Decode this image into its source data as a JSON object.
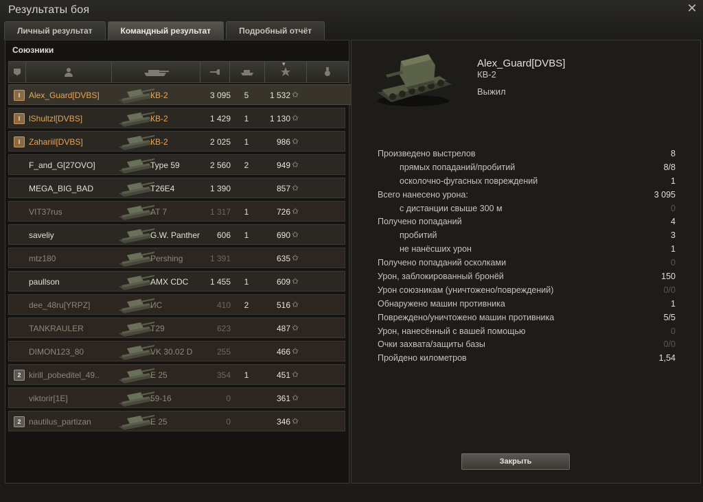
{
  "window": {
    "title": "Результаты боя"
  },
  "tabs": [
    {
      "label": "Личный результат"
    },
    {
      "label": "Командный результат"
    },
    {
      "label": "Подробный отчёт"
    }
  ],
  "allies": {
    "label": "Союзники",
    "columns": [
      "platoon-icon",
      "player-icon",
      "tank-icon",
      "damage-icon",
      "kills-icon",
      "experience-star-icon",
      "medal-icon"
    ],
    "rows": [
      {
        "player": "Alex_Guard[DVBS]",
        "tank": "КВ-2",
        "damage": "3 095",
        "kills": "5",
        "xp": "1 532",
        "platoon": "I",
        "color": "#e8a655"
      },
      {
        "player": "lShultzl[DVBS]",
        "tank": "КВ-2",
        "damage": "1 429",
        "kills": "1",
        "xp": "1 130",
        "platoon": "I",
        "color": "#e8a655"
      },
      {
        "player": "Zahariil[DVBS]",
        "tank": "КВ-2",
        "damage": "2 025",
        "kills": "1",
        "xp": "986",
        "platoon": "I",
        "color": "#e8a655"
      },
      {
        "player": "F_and_G[27OVO]",
        "tank": "Type 59",
        "damage": "2 560",
        "kills": "2",
        "xp": "949",
        "platoon": "",
        "color": "#e2dfd5"
      },
      {
        "player": "MEGA_BIG_BAD",
        "tank": "T26E4",
        "damage": "1 390",
        "kills": "",
        "xp": "857",
        "platoon": "",
        "color": "#e2dfd5"
      },
      {
        "player": "VIT37rus",
        "tank": "AT 7",
        "damage": "1 317",
        "kills": "1",
        "xp": "726",
        "platoon": "",
        "color": "#8b867a"
      },
      {
        "player": "saveliy",
        "tank": "G.W. Panther",
        "damage": "606",
        "kills": "1",
        "xp": "690",
        "platoon": "",
        "color": "#e2dfd5"
      },
      {
        "player": "mtz180",
        "tank": "Pershing",
        "damage": "1 391",
        "kills": "",
        "xp": "635",
        "platoon": "",
        "color": "#8b867a"
      },
      {
        "player": "paullson",
        "tank": "AMX CDC",
        "damage": "1 455",
        "kills": "1",
        "xp": "609",
        "platoon": "",
        "color": "#e2dfd5"
      },
      {
        "player": "dee_48ru[YRPZ]",
        "tank": "ИС",
        "damage": "410",
        "kills": "2",
        "xp": "516",
        "platoon": "",
        "color": "#8b867a"
      },
      {
        "player": "TANKRAULER",
        "tank": "T29",
        "damage": "623",
        "kills": "",
        "xp": "487",
        "platoon": "",
        "color": "#8b867a"
      },
      {
        "player": "DIMON123_80",
        "tank": "VK 30.02 D",
        "damage": "255",
        "kills": "",
        "xp": "466",
        "platoon": "",
        "color": "#8b867a"
      },
      {
        "player": "kirill_pobeditel_49..",
        "tank": "E 25",
        "damage": "354",
        "kills": "1",
        "xp": "451",
        "platoon": "2",
        "color": "#8b867a"
      },
      {
        "player": "viktorir[1E]",
        "tank": "59-16",
        "damage": "0",
        "kills": "",
        "xp": "361",
        "platoon": "",
        "color": "#8b867a"
      },
      {
        "player": "nautilus_partizan",
        "tank": "E 25",
        "damage": "0",
        "kills": "",
        "xp": "346",
        "platoon": "2",
        "color": "#8b867a"
      }
    ]
  },
  "detail": {
    "player": "Alex_Guard[DVBS]",
    "tank": "КВ-2",
    "status": "Выжил",
    "stats": [
      {
        "label": "Произведено выстрелов",
        "value": "8",
        "indent": false
      },
      {
        "label": "прямых попаданий/пробитий",
        "value": "8/8",
        "indent": true
      },
      {
        "label": "осколочно-фугасных повреждений",
        "value": "1",
        "indent": true
      },
      {
        "label": "Всего нанесено урона:",
        "value": "3 095",
        "indent": false
      },
      {
        "label": "с дистанции свыше 300 м",
        "value": "0",
        "indent": true,
        "zero": true
      },
      {
        "label": "Получено попаданий",
        "value": "4",
        "indent": false
      },
      {
        "label": "пробитий",
        "value": "3",
        "indent": true
      },
      {
        "label": "не нанёсших урон",
        "value": "1",
        "indent": true
      },
      {
        "label": "Получено попаданий осколками",
        "value": "0",
        "indent": false,
        "zero": true
      },
      {
        "label": "Урон, заблокированный бронёй",
        "value": "150",
        "indent": false
      },
      {
        "label": "Урон союзникам (уничтожено/повреждений)",
        "value": "0/0",
        "indent": false,
        "zero": true
      },
      {
        "label": "Обнаружено машин противника",
        "value": "1",
        "indent": false
      },
      {
        "label": "Повреждено/уничтожено машин противника",
        "value": "5/5",
        "indent": false
      },
      {
        "label": "Урон, нанесённый с вашей помощью",
        "value": "0",
        "indent": false,
        "zero": true
      },
      {
        "label": "Очки захвата/защиты базы",
        "value": "0/0",
        "indent": false,
        "zero": true
      },
      {
        "label": "Пройдено километров",
        "value": "1,54",
        "indent": false
      }
    ],
    "close_label": "Закрыть"
  }
}
